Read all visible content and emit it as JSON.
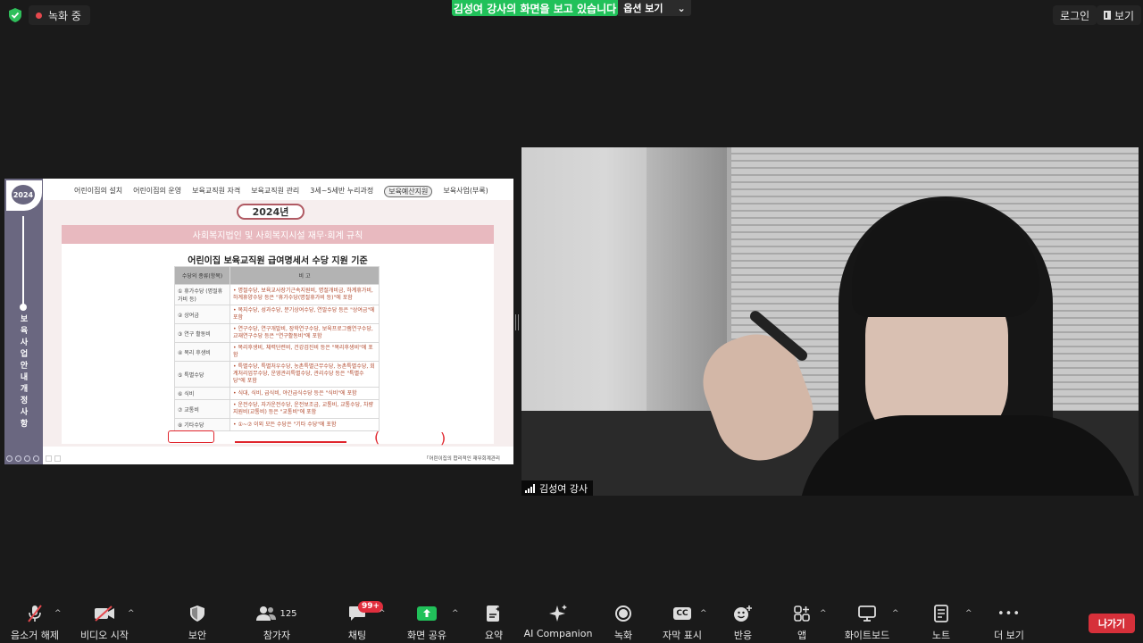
{
  "top": {
    "recording_label": "녹화 중",
    "share_banner": "김성여 강사의 화면을 보고 있습니다",
    "options_label": "옵션 보기",
    "options_caret": "⌄",
    "login_label": "로그인",
    "view_label": "보기"
  },
  "slide": {
    "year_badge": "2024",
    "side_title": "보육사업안내개정사항",
    "nav": [
      "어린이집의 설치",
      "어린이집의 운영",
      "보육교직원 자격",
      "보육교직원 관리",
      "3세~5세반 누리과정",
      "보육예산지원",
      "보육사업(부록)"
    ],
    "year_pill": "2024년",
    "header": "사회복지법인 및 사회복지시설 재무·회계 규칙",
    "card_title": "어린이집 보육교직원 급여명세서 수당 지원 기준",
    "table": {
      "headers": [
        "수당의 종류(항목)",
        "비 고"
      ],
      "rows": [
        {
          "type": "① 휴가수당 (명절휴가비 등)",
          "desc": "• 명절수당, 보육교사장기근속지원비, 명절개비금, 하계휴가비, 하계휴양수당 등은 \"휴가수당(명절휴가비 등)\"에 포함"
        },
        {
          "type": "② 상여금",
          "desc": "• 복지수당, 성과수당, 분기상여수당, 연말수당 등은 \"상여금\"에 포함"
        },
        {
          "type": "③ 연구 활동비",
          "desc": "• 연구수당, 연구개발비, 장학연구수당, 보육프로그램연구수당, 교재연구수당 등은 \"연구활동비\"에 포함"
        },
        {
          "type": "④ 복리 후생비",
          "desc": "• 복리후생비, 체력단련비, 건강검진비 등은 \"복리후생비\"에 포함"
        },
        {
          "type": "⑤ 특별수당",
          "desc": "• 특별수당, 특별처우수당, 농촌특별근무수당, 농촌특별수당, 회계처리업무수당, 운영관리특별수당, 관리수당 등은 \"특별수당\"에 포함"
        },
        {
          "type": "⑥ 식비",
          "desc": "• 식대, 식비, 급식비, 야간급식수당 등은 \"식비\"에 포함"
        },
        {
          "type": "⑦ 교통비",
          "desc": "• 운전수당, 자가운전수당, 운전보조금, 교통비, 교통수당, 차량지원비(교통비) 등은 \"교통비\"에 포함"
        },
        {
          "type": "⑧ 기타수당",
          "desc": "• ①~⑦ 이외 모든 수당은 \"기타 수당\"에 포함"
        }
      ]
    },
    "footer_note": "「어린이집의 합리적인 재무회계관리",
    "annotation_paren_left": "(",
    "annotation_paren_right": ")"
  },
  "video": {
    "participant_name": "김성여 강사"
  },
  "toolbar": {
    "items": [
      {
        "label": "음소거 해제",
        "icon": "mic-muted-icon"
      },
      {
        "label": "비디오 시작",
        "icon": "video-off-icon"
      },
      {
        "label": "보안",
        "icon": "shield-icon"
      },
      {
        "label": "참가자",
        "icon": "participants-icon",
        "count": "125"
      },
      {
        "label": "채팅",
        "icon": "chat-icon",
        "badge": "99+"
      },
      {
        "label": "화면 공유",
        "icon": "share-screen-icon"
      },
      {
        "label": "요약",
        "icon": "summary-icon"
      },
      {
        "label": "AI Companion",
        "icon": "ai-companion-icon"
      },
      {
        "label": "녹화",
        "icon": "record-icon"
      },
      {
        "label": "자막 표시",
        "icon": "cc-icon",
        "cc_text": "CC"
      },
      {
        "label": "반응",
        "icon": "reaction-icon"
      },
      {
        "label": "앱",
        "icon": "apps-icon"
      },
      {
        "label": "화이트보드",
        "icon": "whiteboard-icon"
      },
      {
        "label": "노트",
        "icon": "notes-icon"
      },
      {
        "label": "더 보기",
        "icon": "more-icon",
        "dots": "•••"
      }
    ],
    "caret": "^",
    "leave_label": "나가기"
  },
  "colors": {
    "share_green": "#21c15a",
    "leave_red": "#d6303a",
    "badge_red": "#e02e3d",
    "slide_sidebar": "#6a6780"
  }
}
